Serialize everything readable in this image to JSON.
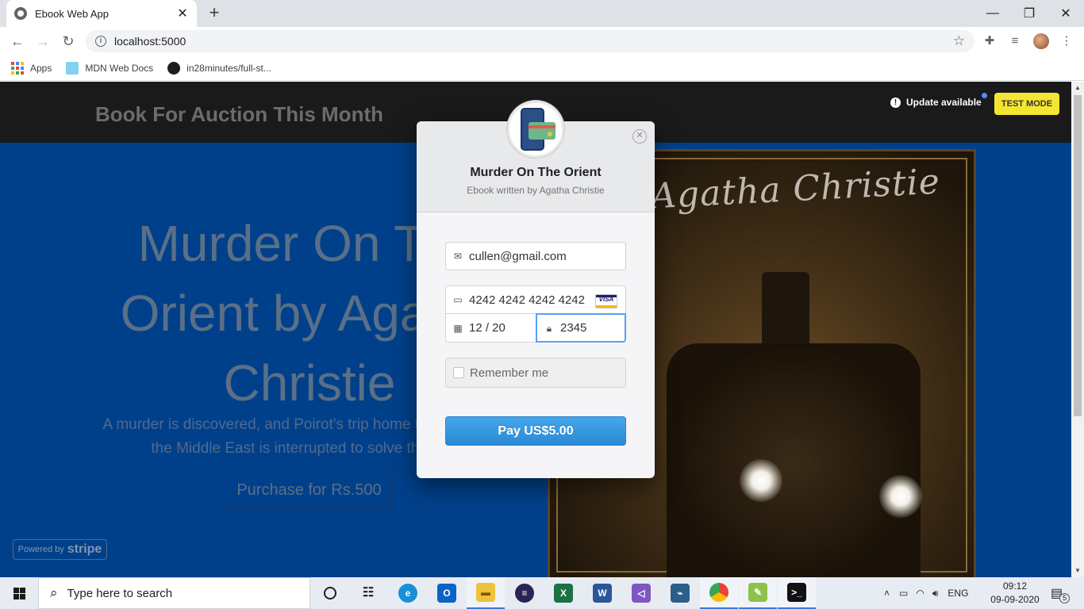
{
  "browser": {
    "tab_title": "Ebook Web App",
    "tab_close": "✕",
    "new_tab": "+",
    "url": "localhost:5000",
    "bookmarks": [
      "Apps",
      "MDN Web Docs",
      "in28minutes/full-st..."
    ],
    "window_controls": {
      "minimize": "—",
      "maximize": "❐",
      "close": "✕"
    }
  },
  "page": {
    "header_title": "Book For Auction This Month",
    "hero_title": "Murder On The Orient by Agatha Christie",
    "hero_description": "A murder is discovered, and Poirot's trip home to London from the Middle East is interrupted to solve the case.",
    "purchase_button": "Purchase for Rs.500",
    "powered_by": "Powered by",
    "powered_brand": "stripe",
    "update_label": "Update available",
    "test_mode": "TEST MODE",
    "cover_author": "Agatha Christie"
  },
  "checkout": {
    "title": "Murder On The Orient",
    "subtitle": "Ebook written by Agatha Christie",
    "email": "cullen@gmail.com",
    "card_number": "4242 4242 4242 4242",
    "card_brand": "VISA",
    "expiry": "12 / 20",
    "cvc": "2345",
    "remember_me": "Remember me",
    "pay_button": "Pay US$5.00"
  },
  "taskbar": {
    "search_placeholder": "Type here to search",
    "language": "ENG",
    "time": "09:12",
    "date": "09-09-2020",
    "notification_count": "5",
    "apps": [
      "task-view",
      "edge",
      "outlook",
      "file-explorer",
      "eclipse",
      "excel",
      "word",
      "visual-studio",
      "mysql-workbench",
      "chrome",
      "notepad",
      "terminal"
    ]
  },
  "colors": {
    "page_bg": "#00408a",
    "header_bg": "#1a1a1a",
    "pay_button": "#2b8ad6",
    "test_mode": "#f5e533"
  }
}
